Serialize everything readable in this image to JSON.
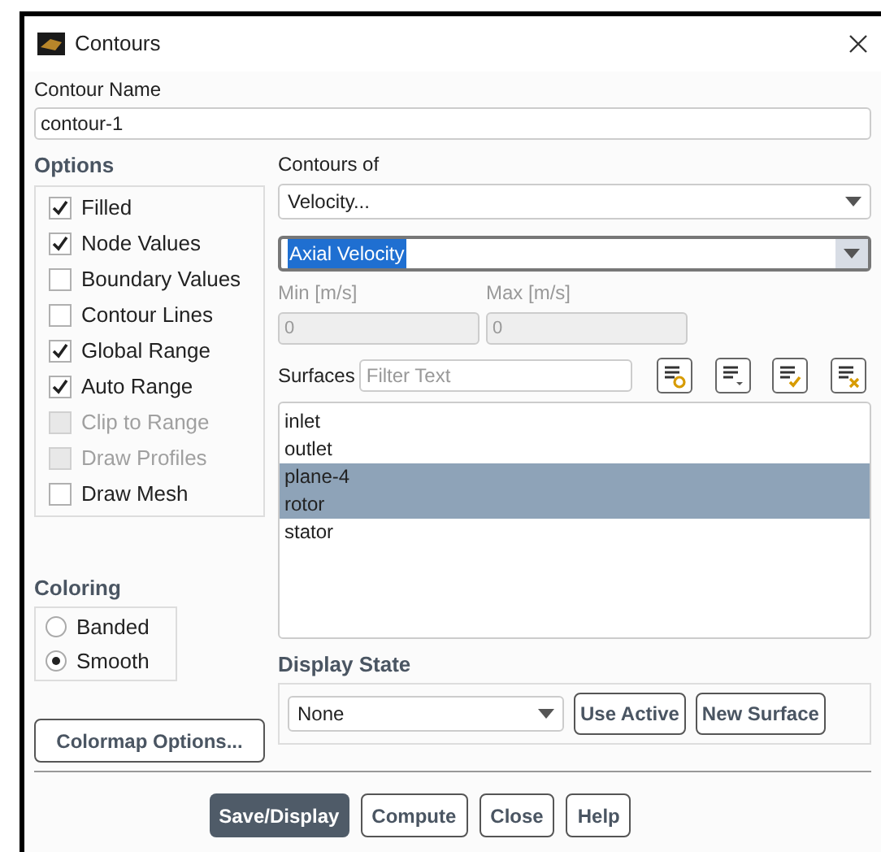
{
  "window": {
    "title": "Contours"
  },
  "contour_name": {
    "label": "Contour Name",
    "value": "contour-1"
  },
  "options": {
    "title": "Options",
    "items": [
      {
        "label": "Filled",
        "checked": true,
        "disabled": false
      },
      {
        "label": "Node Values",
        "checked": true,
        "disabled": false
      },
      {
        "label": "Boundary Values",
        "checked": false,
        "disabled": false
      },
      {
        "label": "Contour Lines",
        "checked": false,
        "disabled": false
      },
      {
        "label": "Global Range",
        "checked": true,
        "disabled": false
      },
      {
        "label": "Auto Range",
        "checked": true,
        "disabled": false
      },
      {
        "label": "Clip to Range",
        "checked": false,
        "disabled": true
      },
      {
        "label": "Draw Profiles",
        "checked": false,
        "disabled": true
      },
      {
        "label": "Draw Mesh",
        "checked": false,
        "disabled": false
      }
    ]
  },
  "coloring": {
    "title": "Coloring",
    "items": [
      {
        "label": "Banded",
        "selected": false
      },
      {
        "label": "Smooth",
        "selected": true
      }
    ]
  },
  "colormap_button": "Colormap Options...",
  "contours_of": {
    "label": "Contours of",
    "category": "Velocity...",
    "quantity": "Axial Velocity"
  },
  "range": {
    "min_label": "Min [m/s]",
    "min_value": "0",
    "max_label": "Max [m/s]",
    "max_value": "0"
  },
  "surfaces": {
    "label": "Surfaces",
    "filter_placeholder": "Filter Text",
    "items": [
      {
        "label": "inlet",
        "selected": false
      },
      {
        "label": "outlet",
        "selected": false
      },
      {
        "label": "plane-4",
        "selected": true
      },
      {
        "label": "rotor",
        "selected": true
      },
      {
        "label": "stator",
        "selected": false
      }
    ]
  },
  "display_state": {
    "title": "Display State",
    "value": "None",
    "use_active": "Use Active",
    "new_surface": "New Surface"
  },
  "buttons": [
    {
      "label": "Save/Display",
      "primary": true
    },
    {
      "label": "Compute",
      "primary": false
    },
    {
      "label": "Close",
      "primary": false
    },
    {
      "label": "Help",
      "primary": false
    }
  ]
}
